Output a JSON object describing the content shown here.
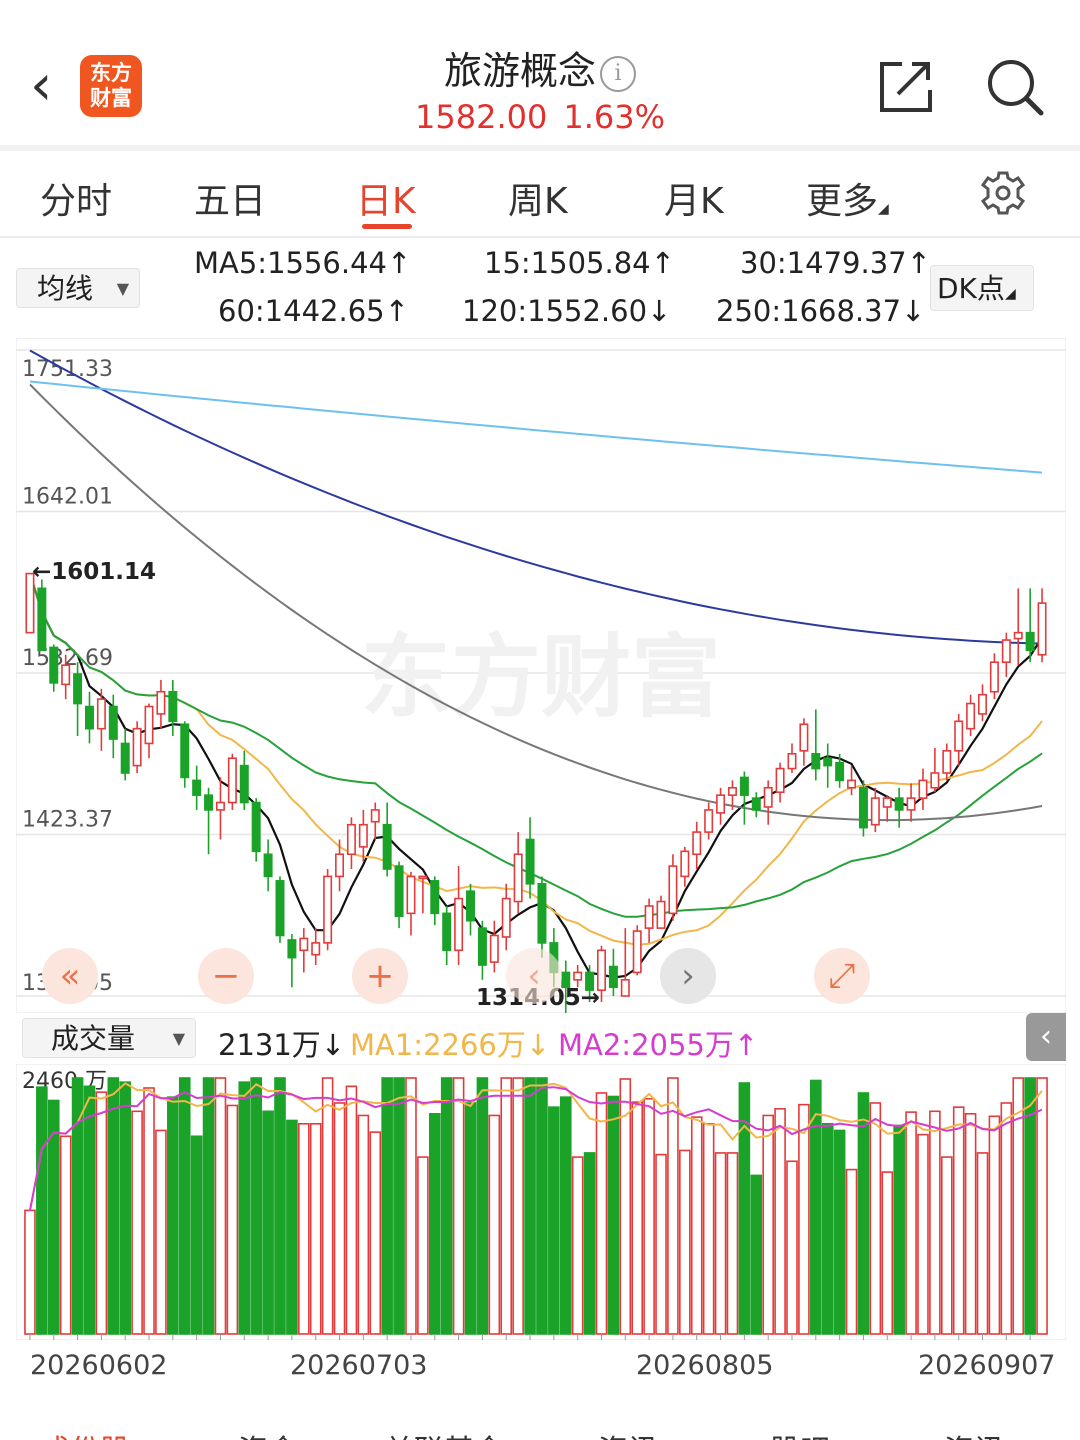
{
  "header": {
    "back_label": "‹",
    "logo_text": "东方财富",
    "title": "旅游概念",
    "info_glyph": "i",
    "price": "1582.00",
    "change_pct": "1.63%"
  },
  "tabs": [
    {
      "label": "分时",
      "active": false
    },
    {
      "label": "五日",
      "active": false
    },
    {
      "label": "日K",
      "active": true
    },
    {
      "label": "周K",
      "active": false
    },
    {
      "label": "月K",
      "active": false
    },
    {
      "label": "更多",
      "active": false
    }
  ],
  "ma_bar": {
    "select_label": "均线",
    "values": [
      {
        "text": "MA5:1556.44↑",
        "color": "#222222"
      },
      {
        "text": "15:1505.84↑",
        "color": "#f2b64a"
      },
      {
        "text": "30:1479.37↑",
        "color": "#27a13a"
      },
      {
        "text": "60:1442.65↑",
        "color": "#666666"
      },
      {
        "text": "120:1552.60↓",
        "color": "#2b3a9f"
      },
      {
        "text": "250:1668.37↓",
        "color": "#6ec1ee"
      }
    ],
    "dk_label": "DK点"
  },
  "kline": {
    "axis_labels": [
      "1751.33",
      "1642.01",
      "1532.69",
      "1423.37",
      "1314.05"
    ],
    "high_marker": "←1601.14",
    "low_marker": "1314.05→",
    "watermark": "东方财富",
    "controls": [
      "«",
      "−",
      "+",
      "‹",
      "›",
      "⤢"
    ]
  },
  "volume_bar": {
    "select_label": "成交量",
    "value": "2131万↓",
    "ma1": "MA1:2266万↓",
    "ma2": "MA2:2055万↑",
    "axis_label": "2460 万",
    "collapse_glyph": "‹"
  },
  "dates": [
    "20260602",
    "20260703",
    "20260805",
    "20260907"
  ],
  "bottom_tabs": [
    "成份股",
    "资金",
    "关联基金",
    "资讯",
    "股吧",
    "资讯"
  ],
  "chart_data": {
    "type": "candlestick",
    "ylim": [
      1314.05,
      1751.33
    ],
    "y_ticks": [
      1751.33,
      1642.01,
      1532.69,
      1423.37,
      1314.05
    ],
    "candles": [
      [
        1560,
        1600,
        1590,
        1599
      ],
      [
        1590,
        1548,
        1555,
        1596
      ],
      [
        1550,
        1526,
        1520,
        1552
      ],
      [
        1525,
        1538,
        1515,
        1545
      ],
      [
        1532,
        1512,
        1490,
        1540
      ],
      [
        1510,
        1495,
        1485,
        1520
      ],
      [
        1495,
        1515,
        1480,
        1522
      ],
      [
        1510,
        1488,
        1475,
        1518
      ],
      [
        1485,
        1465,
        1460,
        1495
      ],
      [
        1470,
        1495,
        1465,
        1500
      ],
      [
        1485,
        1510,
        1475,
        1512
      ],
      [
        1505,
        1520,
        1495,
        1528
      ],
      [
        1520,
        1500,
        1490,
        1528
      ],
      [
        1498,
        1462,
        1455,
        1500
      ],
      [
        1460,
        1450,
        1440,
        1470
      ],
      [
        1450,
        1440,
        1410,
        1455
      ],
      [
        1440,
        1445,
        1420,
        1462
      ],
      [
        1445,
        1475,
        1440,
        1478
      ],
      [
        1470,
        1445,
        1440,
        1480
      ],
      [
        1445,
        1412,
        1405,
        1448
      ],
      [
        1410,
        1395,
        1385,
        1420
      ],
      [
        1392,
        1355,
        1350,
        1395
      ],
      [
        1352,
        1340,
        1320,
        1356
      ],
      [
        1345,
        1353,
        1330,
        1360
      ],
      [
        1342,
        1350,
        1335,
        1360
      ],
      [
        1350,
        1395,
        1345,
        1400
      ],
      [
        1395,
        1410,
        1385,
        1420
      ],
      [
        1410,
        1430,
        1400,
        1435
      ],
      [
        1415,
        1430,
        1405,
        1440
      ],
      [
        1432,
        1440,
        1420,
        1445
      ],
      [
        1430,
        1400,
        1395,
        1445
      ],
      [
        1402,
        1368,
        1360,
        1405
      ],
      [
        1370,
        1395,
        1355,
        1398
      ],
      [
        1395,
        1395,
        1370,
        1395
      ],
      [
        1392,
        1370,
        1362,
        1395
      ],
      [
        1370,
        1345,
        1335,
        1375
      ],
      [
        1345,
        1380,
        1335,
        1402
      ],
      [
        1385,
        1365,
        1355,
        1390
      ],
      [
        1360,
        1335,
        1325,
        1365
      ],
      [
        1337,
        1355,
        1330,
        1365
      ],
      [
        1354,
        1380,
        1345,
        1390
      ],
      [
        1378,
        1410,
        1370,
        1425
      ],
      [
        1420,
        1390,
        1380,
        1435
      ],
      [
        1390,
        1350,
        1340,
        1395
      ],
      [
        1350,
        1330,
        1320,
        1360
      ],
      [
        1330,
        1320,
        1300,
        1338
      ],
      [
        1325,
        1330,
        1320,
        1335
      ],
      [
        1330,
        1318,
        1310,
        1335
      ],
      [
        1318,
        1345,
        1310,
        1348
      ],
      [
        1334,
        1320,
        1314.05,
        1346
      ],
      [
        1314.05,
        1325,
        1314.05,
        1360
      ],
      [
        1330,
        1358,
        1328,
        1362
      ],
      [
        1360,
        1375,
        1350,
        1380
      ],
      [
        1360,
        1378,
        1360,
        1382
      ],
      [
        1370,
        1402,
        1365,
        1410
      ],
      [
        1395,
        1412,
        1388,
        1415
      ],
      [
        1410,
        1425,
        1400,
        1432
      ],
      [
        1425,
        1440,
        1420,
        1445
      ],
      [
        1438,
        1450,
        1430,
        1455
      ],
      [
        1450,
        1455,
        1440,
        1460
      ],
      [
        1462,
        1450,
        1430,
        1466
      ],
      [
        1448,
        1440,
        1435,
        1452
      ],
      [
        1442,
        1455,
        1430,
        1460
      ],
      [
        1452,
        1468,
        1445,
        1472
      ],
      [
        1468,
        1478,
        1465,
        1485
      ],
      [
        1480,
        1498,
        1470,
        1502
      ],
      [
        1478,
        1468,
        1460,
        1508
      ],
      [
        1475,
        1470,
        1455,
        1485
      ],
      [
        1472,
        1460,
        1455,
        1478
      ],
      [
        1455,
        1460,
        1450,
        1470
      ],
      [
        1455,
        1428,
        1422,
        1460
      ],
      [
        1430,
        1448,
        1425,
        1455
      ],
      [
        1442,
        1448,
        1432,
        1450
      ],
      [
        1448,
        1440,
        1428,
        1455
      ],
      [
        1440,
        1448,
        1432,
        1458
      ],
      [
        1448,
        1460,
        1440,
        1468
      ],
      [
        1455,
        1465,
        1452,
        1482
      ],
      [
        1465,
        1480,
        1460,
        1485
      ],
      [
        1480,
        1500,
        1470,
        1505
      ],
      [
        1495,
        1512,
        1490,
        1518
      ],
      [
        1505,
        1518,
        1500,
        1525
      ],
      [
        1520,
        1540,
        1515,
        1546
      ],
      [
        1540,
        1555,
        1530,
        1560
      ],
      [
        1556,
        1560,
        1538,
        1590
      ],
      [
        1560,
        1548,
        1540,
        1590
      ],
      [
        1545,
        1580,
        1540,
        1590
      ]
    ],
    "ma_lines": [
      {
        "name": "MA5",
        "color": "#111111"
      },
      {
        "name": "15",
        "color": "#f2b64a"
      },
      {
        "name": "30",
        "color": "#27a13a"
      },
      {
        "name": "60",
        "color": "#777777"
      },
      {
        "name": "120",
        "color": "#2b3a9f"
      },
      {
        "name": "250",
        "color": "#6ec1ee"
      }
    ],
    "volume_max": 2460,
    "volume_unit": "万"
  }
}
